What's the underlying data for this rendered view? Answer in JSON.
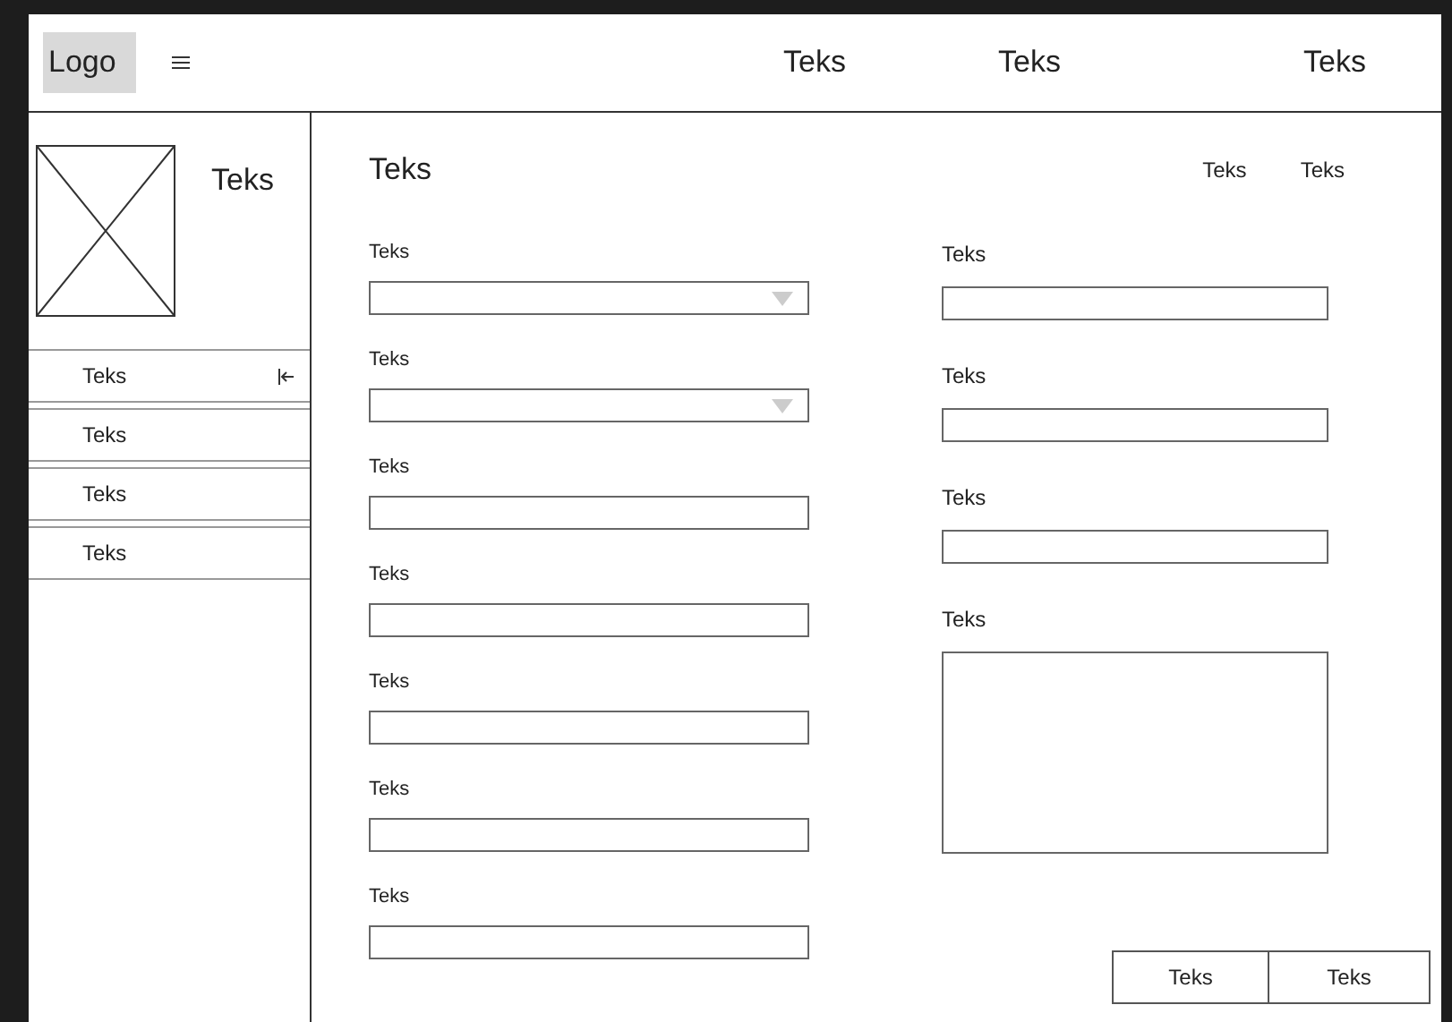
{
  "header": {
    "logo": "Logo",
    "nav": [
      "Teks",
      "Teks",
      "Teks"
    ]
  },
  "sidebar": {
    "profile_name": "Teks",
    "items": [
      {
        "label": "Teks",
        "collapse": true
      },
      {
        "label": "Teks",
        "collapse": false
      },
      {
        "label": "Teks",
        "collapse": false
      },
      {
        "label": "Teks",
        "collapse": false
      }
    ]
  },
  "main": {
    "title": "Teks",
    "links": [
      "Teks",
      "Teks"
    ],
    "left_fields": [
      {
        "kind": "dropdown",
        "label": "Teks"
      },
      {
        "kind": "dropdown",
        "label": "Teks"
      },
      {
        "kind": "text",
        "label": "Teks"
      },
      {
        "kind": "text",
        "label": "Teks"
      },
      {
        "kind": "text",
        "label": "Teks"
      },
      {
        "kind": "text",
        "label": "Teks"
      },
      {
        "kind": "text",
        "label": "Teks"
      }
    ],
    "right_fields": [
      {
        "kind": "text",
        "label": "Teks"
      },
      {
        "kind": "text",
        "label": "Teks"
      },
      {
        "kind": "text",
        "label": "Teks"
      },
      {
        "kind": "textarea",
        "label": "Teks"
      }
    ],
    "buttons": [
      "Teks",
      "Teks"
    ]
  }
}
